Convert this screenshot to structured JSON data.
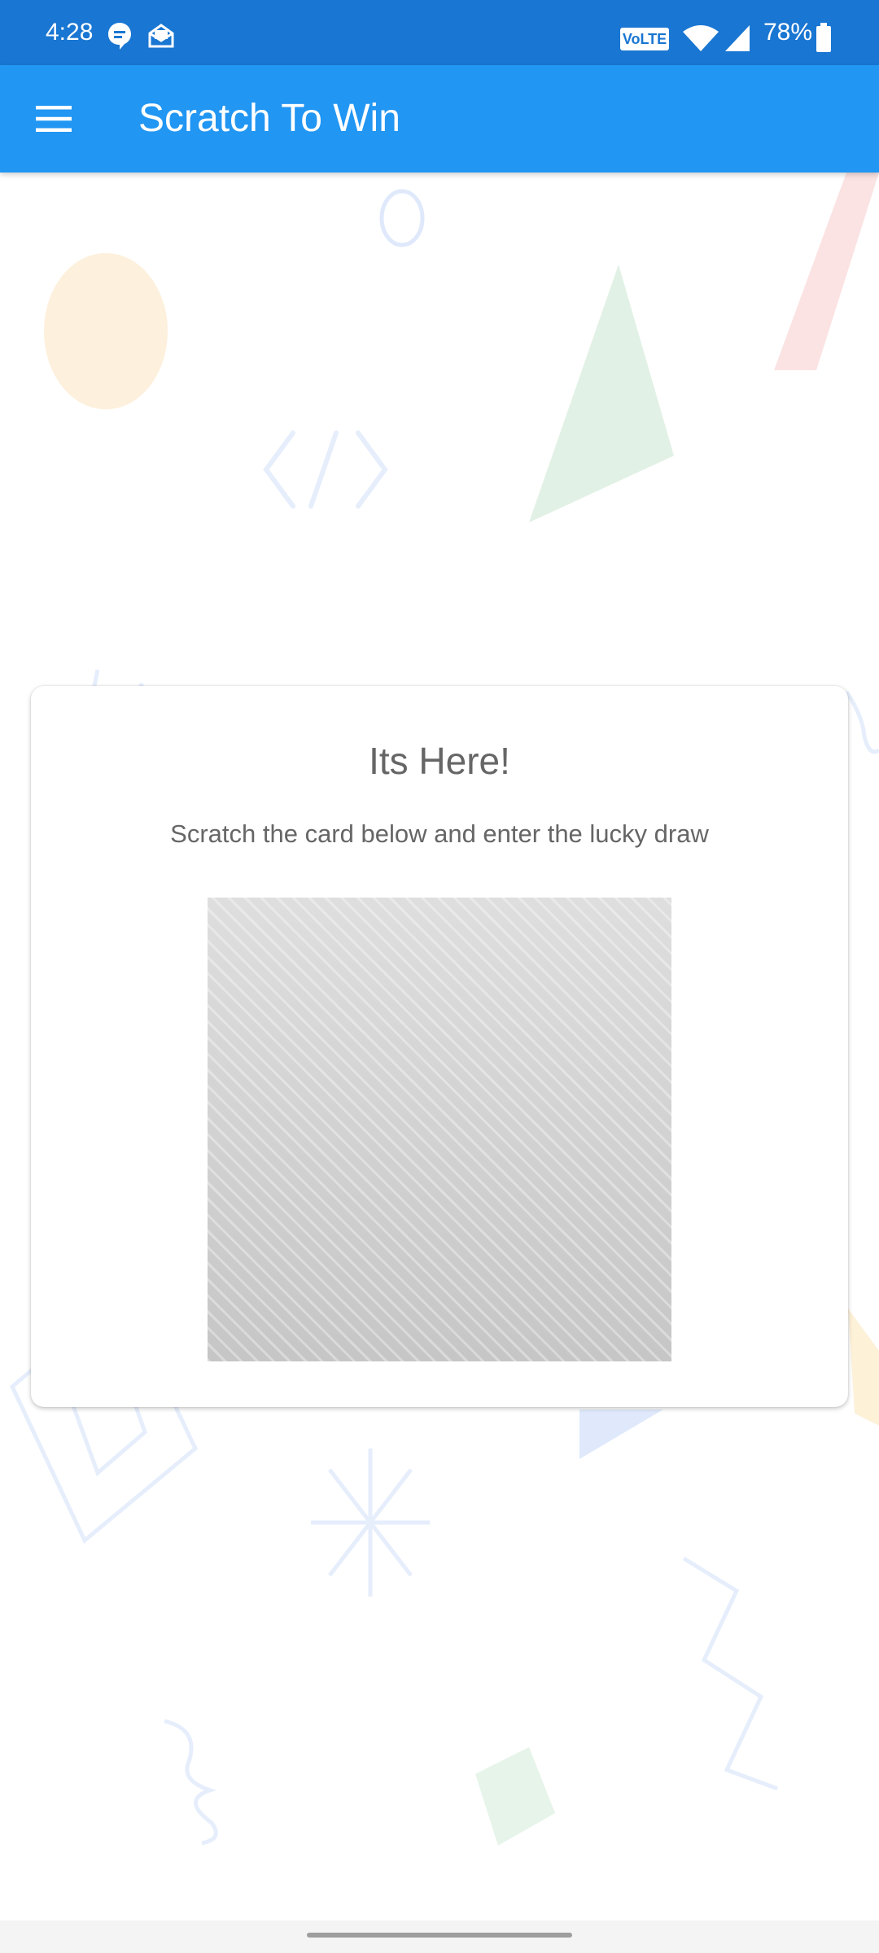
{
  "status_bar": {
    "time": "4:28",
    "battery_percent": "78%",
    "volte_label": "VoLTE",
    "icons": [
      "chat-notification-icon",
      "mail-notification-icon",
      "volte-icon",
      "wifi-icon",
      "cell-signal-icon",
      "battery-icon"
    ]
  },
  "app_bar": {
    "title": "Scratch To Win",
    "menu_icon": "hamburger-menu-icon"
  },
  "card": {
    "title": "Its Here!",
    "subtitle": "Scratch the card below and enter the lucky draw"
  },
  "colors": {
    "status_bar": "#1976d2",
    "app_bar": "#2196f3",
    "card_text": "#666666",
    "scratch_surface": "#d0d0d0"
  }
}
